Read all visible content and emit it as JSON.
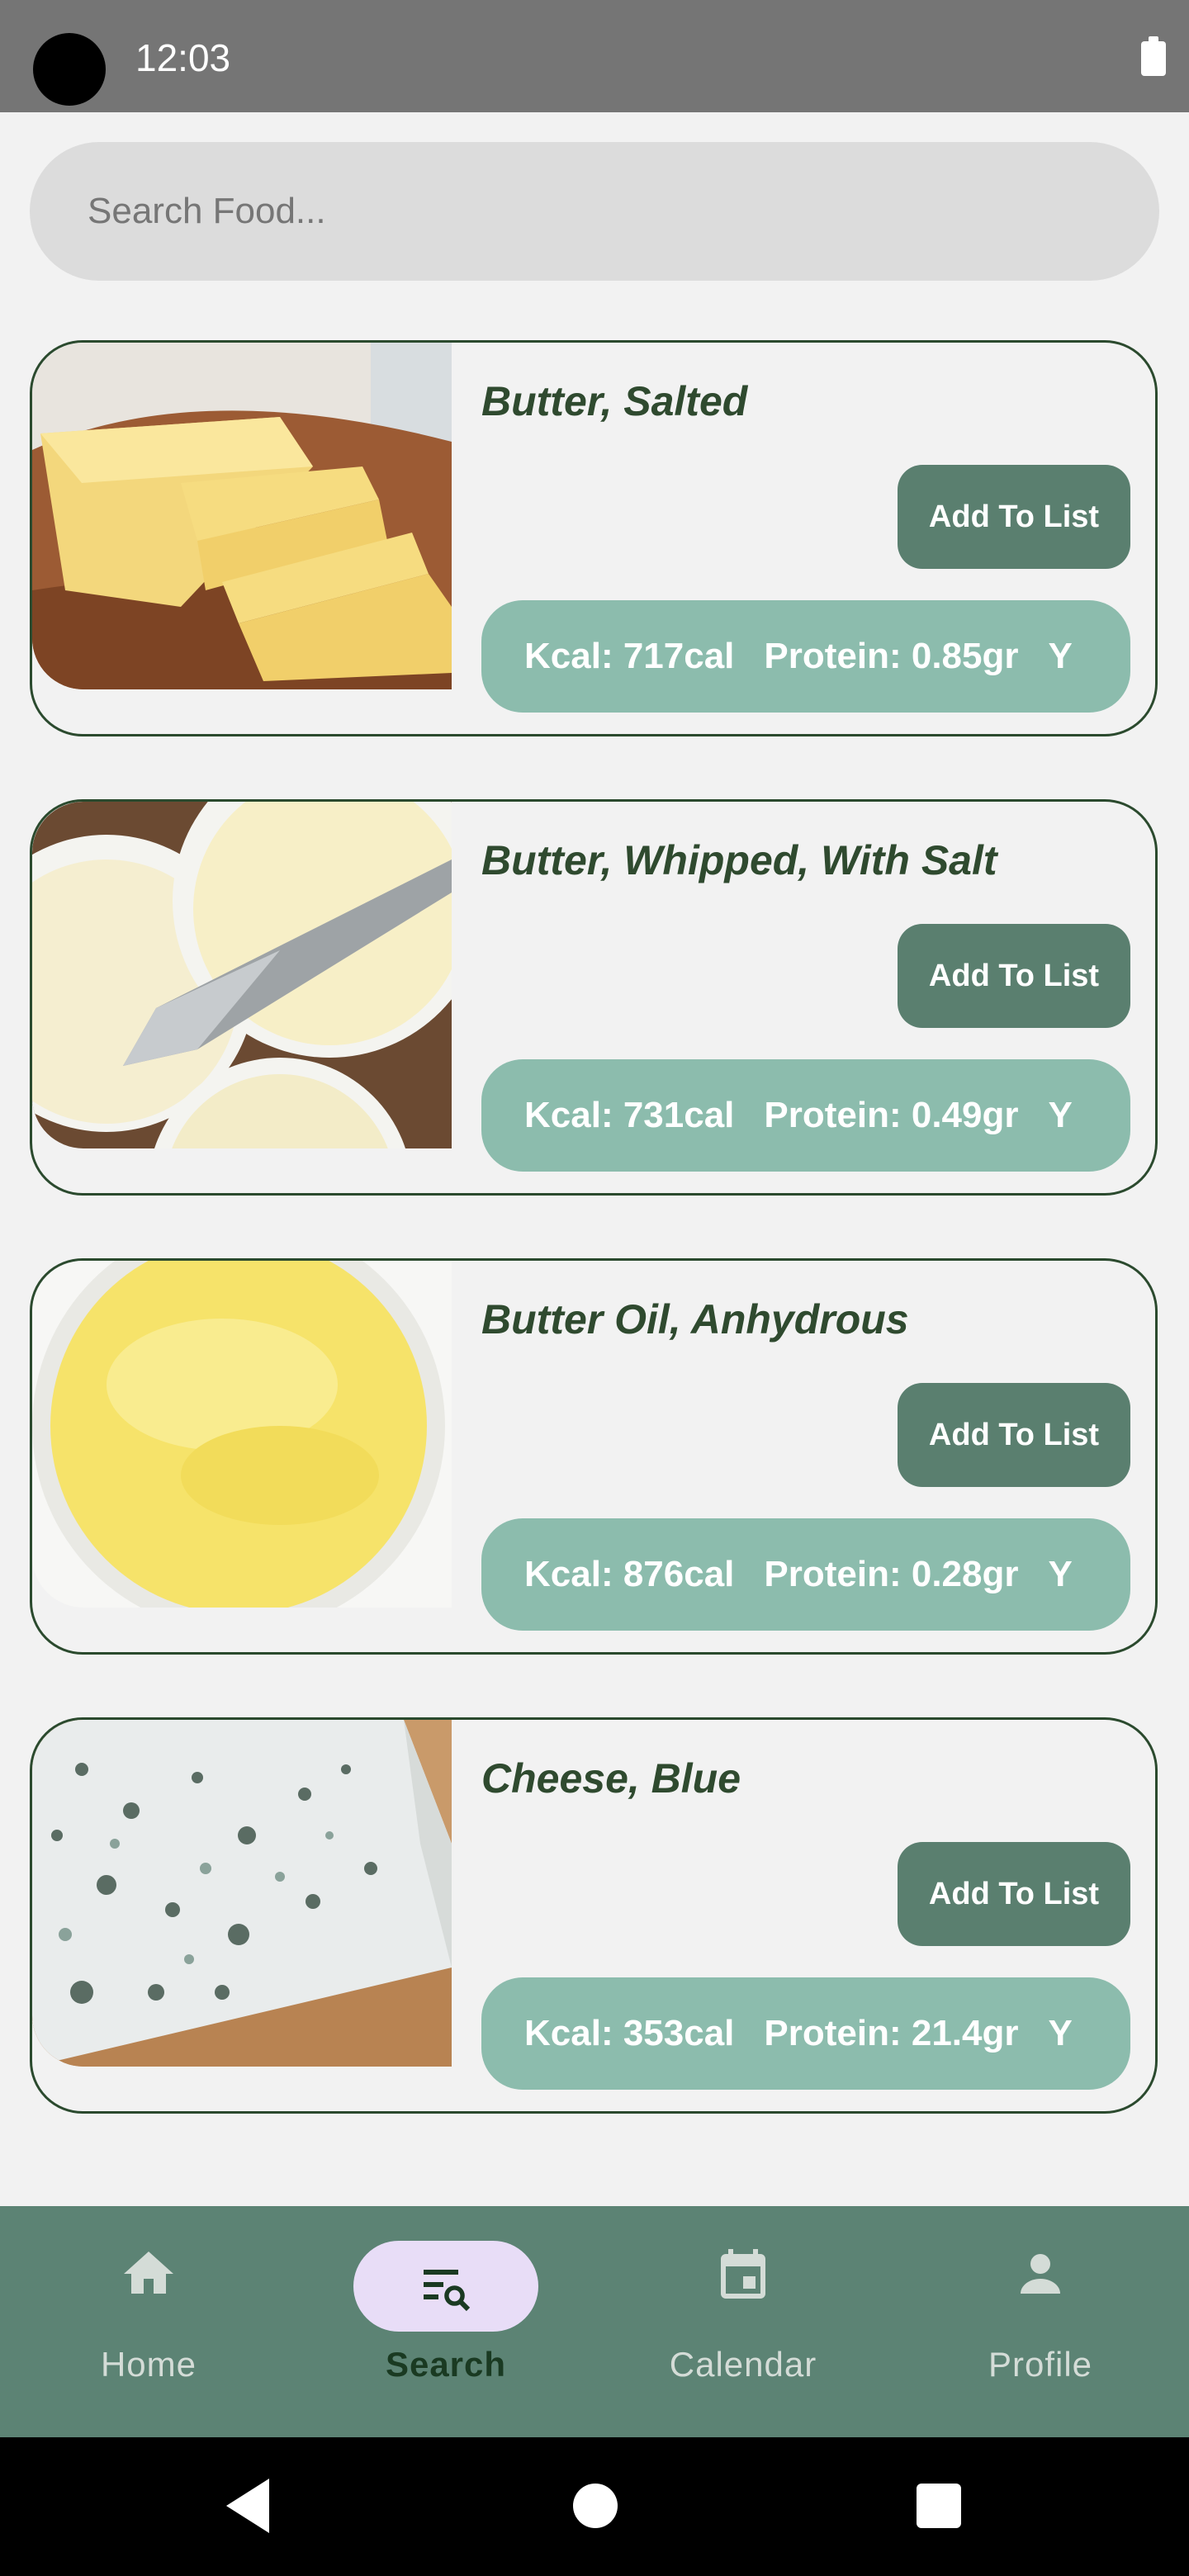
{
  "status_bar": {
    "time": "12:03"
  },
  "search": {
    "placeholder": "Search Food..."
  },
  "foods": [
    {
      "name": "Butter, Salted",
      "add_label": "Add To List",
      "kcal": "Kcal:  717cal",
      "protein": "Protein: 0.85gr",
      "more": "Y"
    },
    {
      "name": "Butter, Whipped, With Salt",
      "add_label": "Add To List",
      "kcal": "Kcal:  731cal",
      "protein": "Protein: 0.49gr",
      "more": "Y"
    },
    {
      "name": "Butter Oil, Anhydrous",
      "add_label": "Add To List",
      "kcal": "Kcal:  876cal",
      "protein": "Protein: 0.28gr",
      "more": "Y"
    },
    {
      "name": "Cheese, Blue",
      "add_label": "Add To List",
      "kcal": "Kcal:  353cal",
      "protein": "Protein: 21.4gr",
      "more": "Y"
    }
  ],
  "bottom_nav": [
    {
      "label": "Home",
      "icon": "home-icon"
    },
    {
      "label": "Search",
      "icon": "search-list-icon",
      "active": true
    },
    {
      "label": "Calendar",
      "icon": "calendar-icon"
    },
    {
      "label": "Profile",
      "icon": "profile-icon"
    }
  ],
  "colors": {
    "status_bar": "#757575",
    "background": "#f2f2f2",
    "accent": "#5a7f6f",
    "stats_pill": "#8cbcad",
    "nav_bar": "#5c8374",
    "active_pill": "#e8ddf7",
    "title_text": "#2f4a2f"
  }
}
